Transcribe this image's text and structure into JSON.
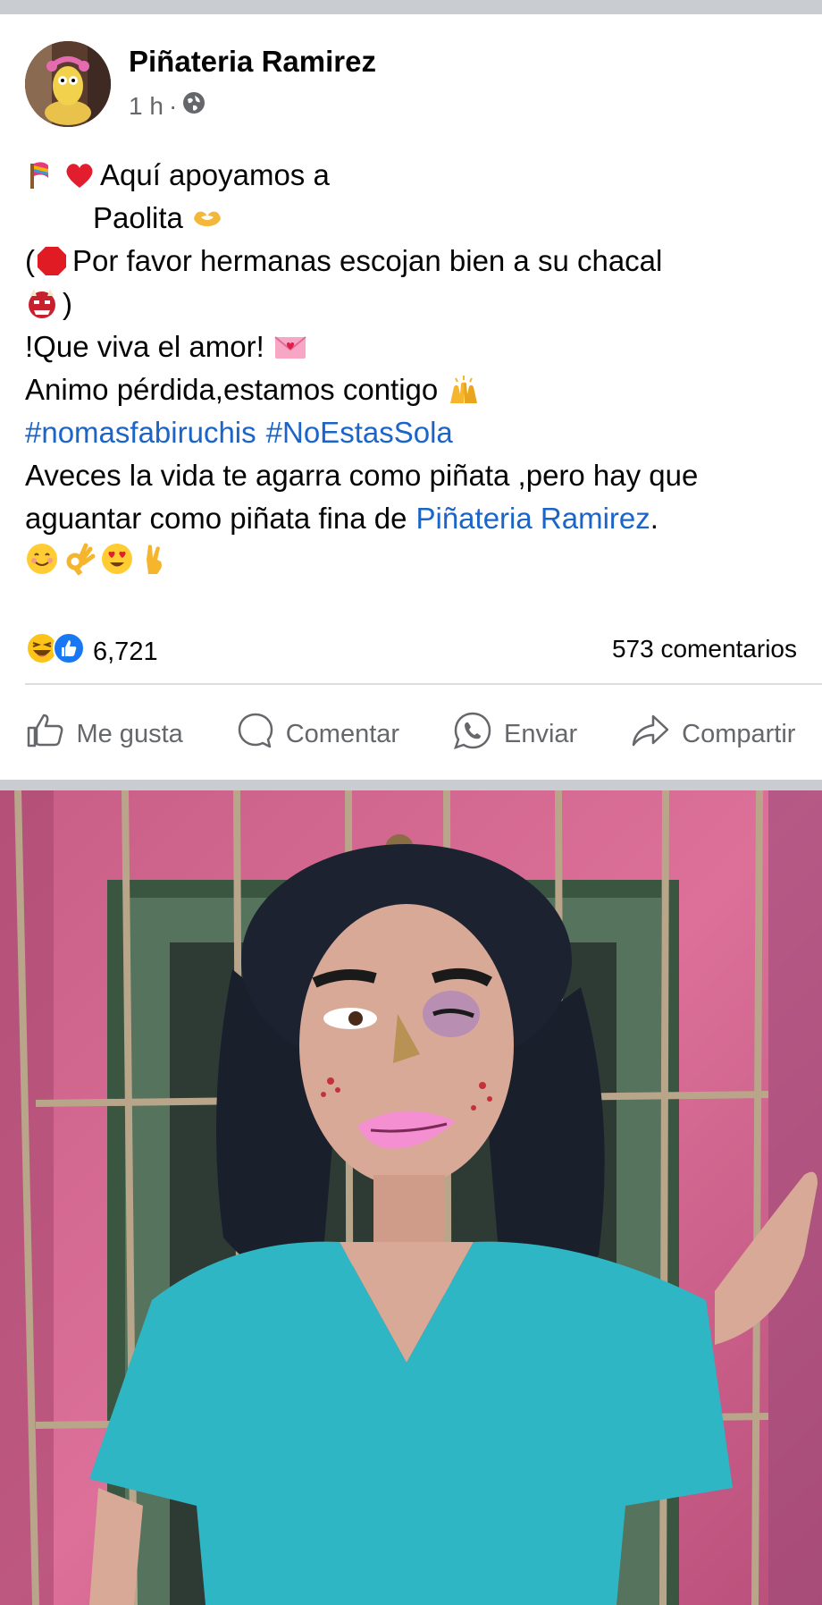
{
  "post": {
    "page_name": "Piñateria Ramirez",
    "time": "1 h",
    "separator": "·",
    "lines": {
      "l1": "Aquí apoyamos a",
      "l2": "Paolita",
      "l3_open": "(",
      "l3": "Por favor hermanas escojan bien a su chacal",
      "l4_close": ")",
      "l5": "!Que viva el amor!",
      "l6": "Animo pérdida,estamos contigo",
      "hashtag1": "#nomasfabiruchis",
      "hashtag2": "#NoEstasSola",
      "l8": "Aveces la vida te agarra como piñata ,pero hay que",
      "l9": "aguantar como piñata fina de",
      "mention": "Piñateria Ramirez",
      "l9_end": "."
    }
  },
  "stats": {
    "reactions_count": "6,721",
    "comments": "573 comentarios"
  },
  "actions": {
    "like": "Me gusta",
    "comment": "Comentar",
    "send": "Enviar",
    "share": "Compartir"
  },
  "icons": [
    "globe-icon",
    "like-icon",
    "comment-icon",
    "whatsapp-icon",
    "share-icon",
    "haha-reaction-icon",
    "like-reaction-icon"
  ],
  "colors": {
    "link": "#1b64c8",
    "secondary_text": "#65676b",
    "photo_wall": "#d5698e",
    "scrubs": "#2fb6c4"
  }
}
